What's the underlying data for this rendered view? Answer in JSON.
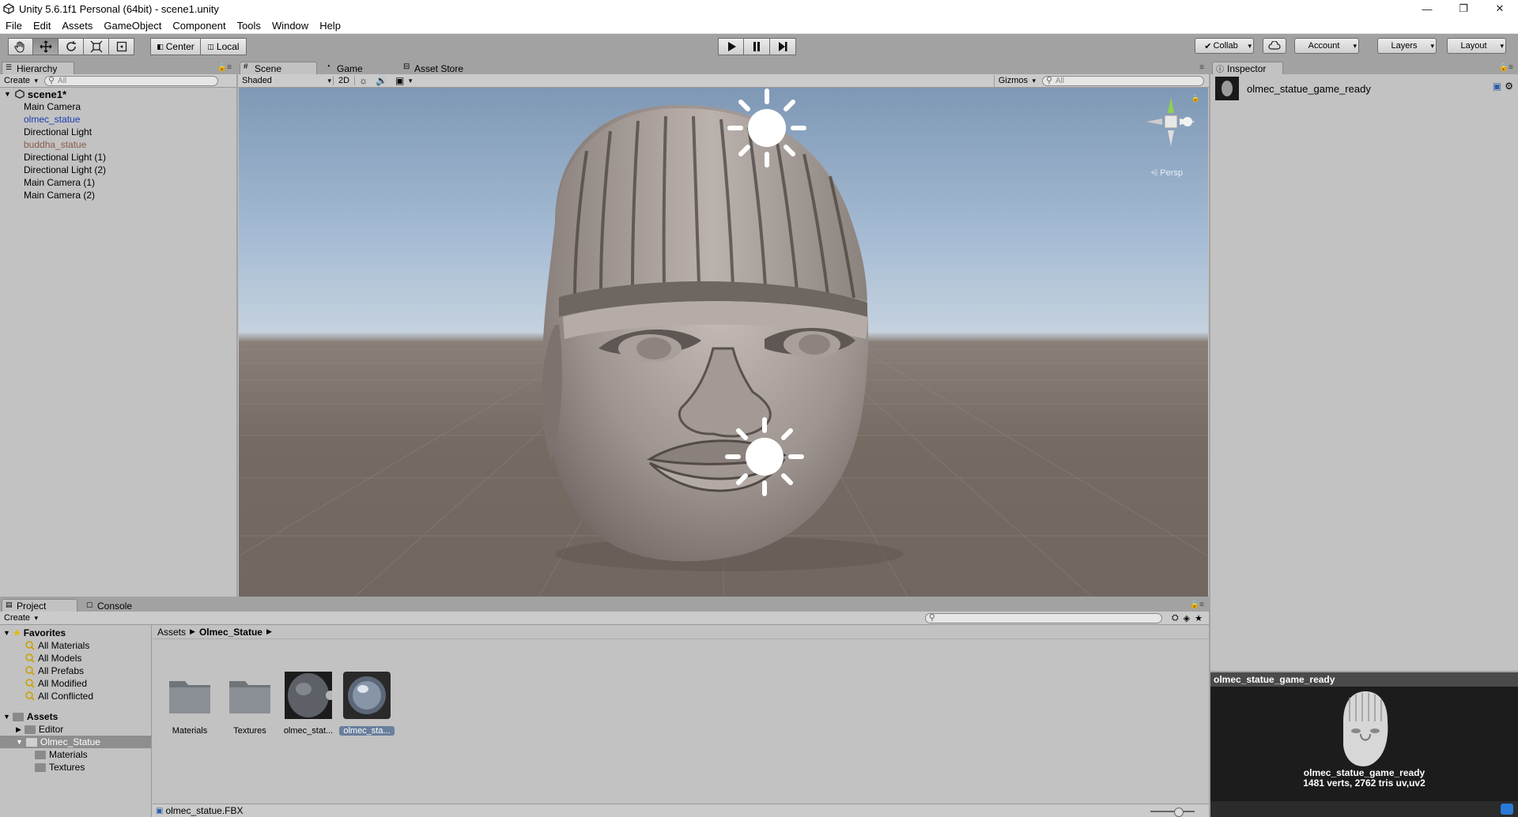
{
  "window": {
    "title": "Unity 5.6.1f1 Personal (64bit) - scene1.unity",
    "minimize": "—",
    "restore": "❐",
    "close": "✕"
  },
  "menu": [
    "File",
    "Edit",
    "Assets",
    "GameObject",
    "Component",
    "Tools",
    "Window",
    "Help"
  ],
  "toolbar": {
    "pivot": "Center",
    "space": "Local",
    "collab": "Collab",
    "account": "Account",
    "layers": "Layers",
    "layout": "Layout"
  },
  "hierarchy": {
    "tab": "Hierarchy",
    "create": "Create",
    "search_placeholder": "All",
    "scene": "scene1*",
    "items": [
      {
        "label": "Main Camera",
        "style": "normal"
      },
      {
        "label": "olmec_statue",
        "style": "prefab"
      },
      {
        "label": "Directional Light",
        "style": "normal"
      },
      {
        "label": "buddha_statue",
        "style": "broken"
      },
      {
        "label": "Directional Light (1)",
        "style": "normal"
      },
      {
        "label": "Directional Light (2)",
        "style": "normal"
      },
      {
        "label": "Main Camera (1)",
        "style": "normal"
      },
      {
        "label": "Main Camera (2)",
        "style": "normal"
      }
    ]
  },
  "scene": {
    "tabs": [
      "Scene",
      "Game",
      "Asset Store"
    ],
    "shading": "Shaded",
    "mode_2d": "2D",
    "gizmos": "Gizmos",
    "search_placeholder": "All",
    "persp": "Persp",
    "sky_color": "#a6bcd4",
    "ground_color": "#756b63"
  },
  "inspector": {
    "tab": "Inspector",
    "object_name": "olmec_statue_game_ready"
  },
  "preview": {
    "title": "olmec_statue_game_ready",
    "name": "olmec_statue_game_ready",
    "stats": "1481 verts, 2762 tris   uv,uv2"
  },
  "project": {
    "tabs": [
      "Project",
      "Console"
    ],
    "create": "Create",
    "favorites_label": "Favorites",
    "favorites": [
      "All Materials",
      "All Models",
      "All Prefabs",
      "All Modified",
      "All Conflicted"
    ],
    "assets_label": "Assets",
    "tree": [
      {
        "label": "Editor",
        "depth": 1,
        "selected": false
      },
      {
        "label": "Olmec_Statue",
        "depth": 1,
        "selected": true
      },
      {
        "label": "Materials",
        "depth": 2,
        "selected": false
      },
      {
        "label": "Textures",
        "depth": 2,
        "selected": false
      }
    ],
    "breadcrumb": [
      "Assets",
      "Olmec_Statue"
    ],
    "assets": [
      {
        "label": "Materials",
        "kind": "folder"
      },
      {
        "label": "Textures",
        "kind": "folder"
      },
      {
        "label": "olmec_stat...",
        "kind": "model"
      },
      {
        "label": "olmec_sta...",
        "kind": "model",
        "selected": true
      }
    ],
    "status_file": "olmec_statue.FBX"
  }
}
